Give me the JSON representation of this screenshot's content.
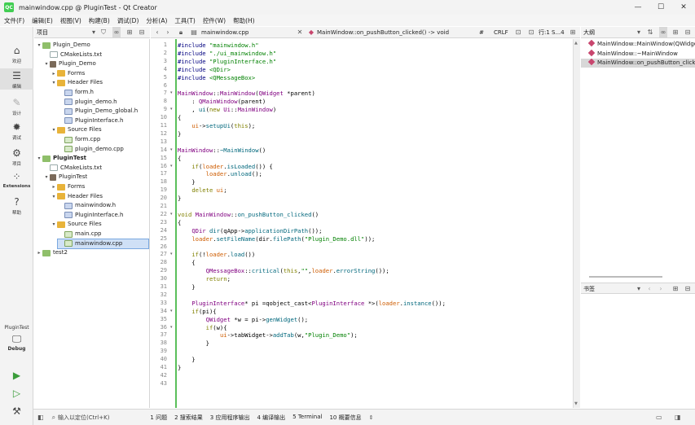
{
  "window": {
    "title": "mainwindow.cpp @ PluginTest - Qt Creator",
    "app_icon": "QC"
  },
  "menu": [
    "文件(F)",
    "编辑(E)",
    "视图(V)",
    "构建(B)",
    "调试(D)",
    "分析(A)",
    "工具(T)",
    "控件(W)",
    "帮助(H)"
  ],
  "modes": [
    {
      "label": "欢迎",
      "icon": "home-icon"
    },
    {
      "label": "编辑",
      "icon": "edit-icon"
    },
    {
      "label": "设计",
      "icon": "design-icon"
    },
    {
      "label": "调试",
      "icon": "debug-icon"
    },
    {
      "label": "项目",
      "icon": "wrench-icon"
    },
    {
      "label": "Extensions",
      "icon": "extensions-icon"
    },
    {
      "label": "帮助",
      "icon": "help-icon"
    }
  ],
  "kit": {
    "project": "PluginTest",
    "config": "Debug"
  },
  "project_panel": {
    "title": "项目"
  },
  "tree": [
    {
      "label": "Plugin_Demo",
      "depth": 0,
      "kind": "proj",
      "arrow": "▾"
    },
    {
      "label": "CMakeLists.txt",
      "depth": 1,
      "kind": "file",
      "arrow": ""
    },
    {
      "label": "Plugin_Demo",
      "depth": 1,
      "kind": "sub",
      "arrow": "▾"
    },
    {
      "label": "Forms",
      "depth": 2,
      "kind": "folder",
      "arrow": "▸"
    },
    {
      "label": "Header Files",
      "depth": 2,
      "kind": "folder",
      "arrow": "▾"
    },
    {
      "label": "form.h",
      "depth": 3,
      "kind": "hdr",
      "arrow": ""
    },
    {
      "label": "plugin_demo.h",
      "depth": 3,
      "kind": "hdr",
      "arrow": ""
    },
    {
      "label": "Plugin_Demo_global.h",
      "depth": 3,
      "kind": "hdr",
      "arrow": ""
    },
    {
      "label": "PluginInterface.h",
      "depth": 3,
      "kind": "hdr",
      "arrow": ""
    },
    {
      "label": "Source Files",
      "depth": 2,
      "kind": "folder",
      "arrow": "▾"
    },
    {
      "label": "form.cpp",
      "depth": 3,
      "kind": "src",
      "arrow": ""
    },
    {
      "label": "plugin_demo.cpp",
      "depth": 3,
      "kind": "src",
      "arrow": ""
    },
    {
      "label": "PluginTest",
      "depth": 0,
      "kind": "proj",
      "arrow": "▾",
      "bold": true
    },
    {
      "label": "CMakeLists.txt",
      "depth": 1,
      "kind": "file",
      "arrow": ""
    },
    {
      "label": "PluginTest",
      "depth": 1,
      "kind": "sub",
      "arrow": "▾"
    },
    {
      "label": "Forms",
      "depth": 2,
      "kind": "folder",
      "arrow": "▸"
    },
    {
      "label": "Header Files",
      "depth": 2,
      "kind": "folder",
      "arrow": "▾"
    },
    {
      "label": "mainwindow.h",
      "depth": 3,
      "kind": "hdr",
      "arrow": ""
    },
    {
      "label": "PluginInterface.h",
      "depth": 3,
      "kind": "hdr",
      "arrow": ""
    },
    {
      "label": "Source Files",
      "depth": 2,
      "kind": "folder",
      "arrow": "▾"
    },
    {
      "label": "main.cpp",
      "depth": 3,
      "kind": "src",
      "arrow": ""
    },
    {
      "label": "mainwindow.cpp",
      "depth": 3,
      "kind": "src",
      "arrow": "",
      "selected": true
    },
    {
      "label": "test2",
      "depth": 0,
      "kind": "proj",
      "arrow": "▸"
    }
  ],
  "editor": {
    "file": "mainwindow.cpp",
    "function": "MainWindow::on_pushButton_clicked() -> void",
    "hash": "#",
    "line_ending": "CRLF",
    "position": "行:1 S...4"
  },
  "code": [
    "#include \"mainwindow.h\"",
    "#include \"./ui_mainwindow.h\"",
    "#include \"PluginInterface.h\"",
    "#include <QDir>",
    "#include <QMessageBox>",
    "",
    "MainWindow::MainWindow(QWidget *parent)",
    "    : QMainWindow(parent)",
    "    , ui(new Ui::MainWindow)",
    "{",
    "    ui->setupUi(this);",
    "}",
    "",
    "MainWindow::~MainWindow()",
    "{",
    "    if(loader.isLoaded()) {",
    "        loader.unload();",
    "    }",
    "    delete ui;",
    "}",
    "",
    "void MainWindow::on_pushButton_clicked()",
    "{",
    "    QDir dir(qApp->applicationDirPath());",
    "    loader.setFileName(dir.filePath(\"Plugin_Demo.dll\"));",
    "",
    "    if(!loader.load())",
    "    {",
    "        QMessageBox::critical(this,\"\",loader.errorString());",
    "        return;",
    "    }",
    "",
    "    PluginInterface* pi =qobject_cast<PluginInterface *>(loader.instance());",
    "    if(pi){",
    "        QWidget *w = pi->genWidget();",
    "        if(w){",
    "            ui->tabWidget->addTab(w,\"Plugin_Demo\");",
    "        }",
    "",
    "    }",
    "}",
    "",
    ""
  ],
  "fold_lines": [
    7,
    9,
    14,
    16,
    22,
    27,
    34,
    36
  ],
  "outline": {
    "title": "大纲",
    "items": [
      "MainWindow::MainWindow(QWidget*)",
      "MainWindow::~MainWindow",
      "MainWindow::on_pushButton_clicked"
    ]
  },
  "bookmarks": {
    "title": "书签"
  },
  "status": {
    "locator_placeholder": "输入以定位(Ctrl+K)",
    "tabs": [
      "1 问题",
      "2 搜索结果",
      "3 应用程序输出",
      "4 编译输出",
      "5 Terminal",
      "10 概要信息"
    ]
  }
}
